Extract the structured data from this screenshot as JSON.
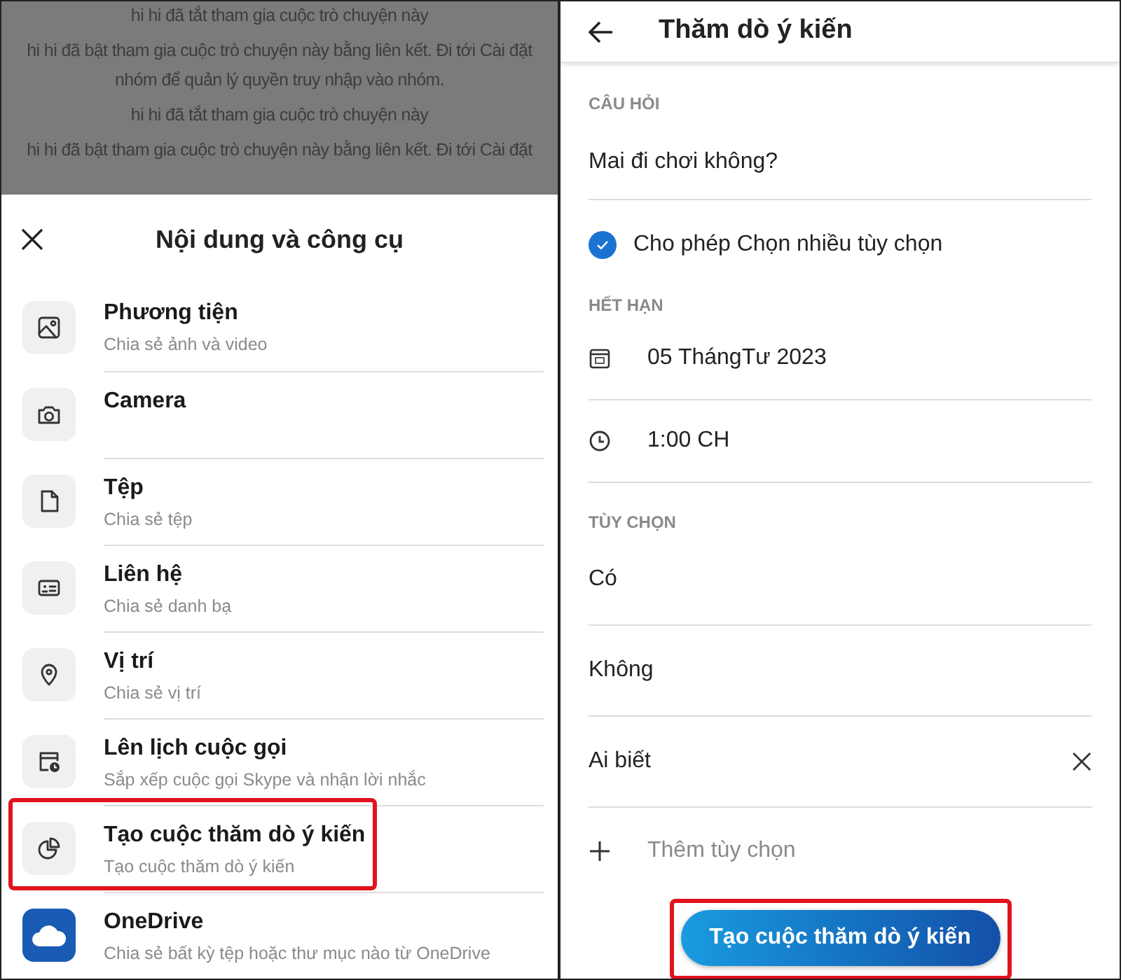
{
  "chat_messages": [
    "hi hi đã tắt tham gia cuộc trò chuyện này",
    "hi hi đã bật tham gia cuộc trò chuyện này bằng liên kết. Đi tới Cài đặt nhóm để quản lý quyền truy nhập vào nhóm.",
    "hi hi đã tắt tham gia cuộc trò chuyện này",
    "hi hi đã bật tham gia cuộc trò chuyện này bằng liên kết. Đi tới Cài đặt"
  ],
  "sheet": {
    "title": "Nội dung và công cụ",
    "items": [
      {
        "title": "Phương tiện",
        "subtitle": "Chia sẻ ảnh và video",
        "highlighted": false
      },
      {
        "title": "Camera",
        "highlighted": false
      },
      {
        "title": "Tệp",
        "subtitle": "Chia sẻ tệp",
        "highlighted": false
      },
      {
        "title": "Liên hệ",
        "subtitle": "Chia sẻ danh bạ",
        "highlighted": false
      },
      {
        "title": "Vị trí",
        "subtitle": "Chia sẻ vị trí",
        "highlighted": false
      },
      {
        "title": "Lên lịch cuộc gọi",
        "subtitle": "Sắp xếp cuộc gọi Skype và nhận lời nhắc",
        "highlighted": false
      },
      {
        "title": "Tạo cuộc thăm dò ý kiến",
        "subtitle": "Tạo cuộc thăm dò ý kiến",
        "highlighted": true
      },
      {
        "title": "OneDrive",
        "subtitle": "Chia sẻ bất kỳ tệp hoặc thư mục nào từ OneDrive",
        "highlighted": false
      }
    ]
  },
  "poll": {
    "title": "Thăm dò ý kiến",
    "question_label": "CÂU HỎI",
    "question": "Mai đi chơi không?",
    "multiple_choice": {
      "label": "Cho phép Chọn nhiều tùy chọn",
      "checked": true
    },
    "expiry_label": "HẾT HẠN",
    "date": "05 ThángTư 2023",
    "time": "1:00 CH",
    "options_label": "TÙY CHỌN",
    "options": [
      {
        "kind": "option",
        "text": "Có",
        "removable": false
      },
      {
        "kind": "option",
        "text": "Không",
        "removable": false
      },
      {
        "kind": "option",
        "text": "Ai biết",
        "removable": true
      },
      {
        "kind": "add",
        "text": "Thêm tùy chọn"
      }
    ],
    "create_button": {
      "label": "Tạo cuộc thăm dò ý kiến",
      "highlighted": true
    }
  }
}
